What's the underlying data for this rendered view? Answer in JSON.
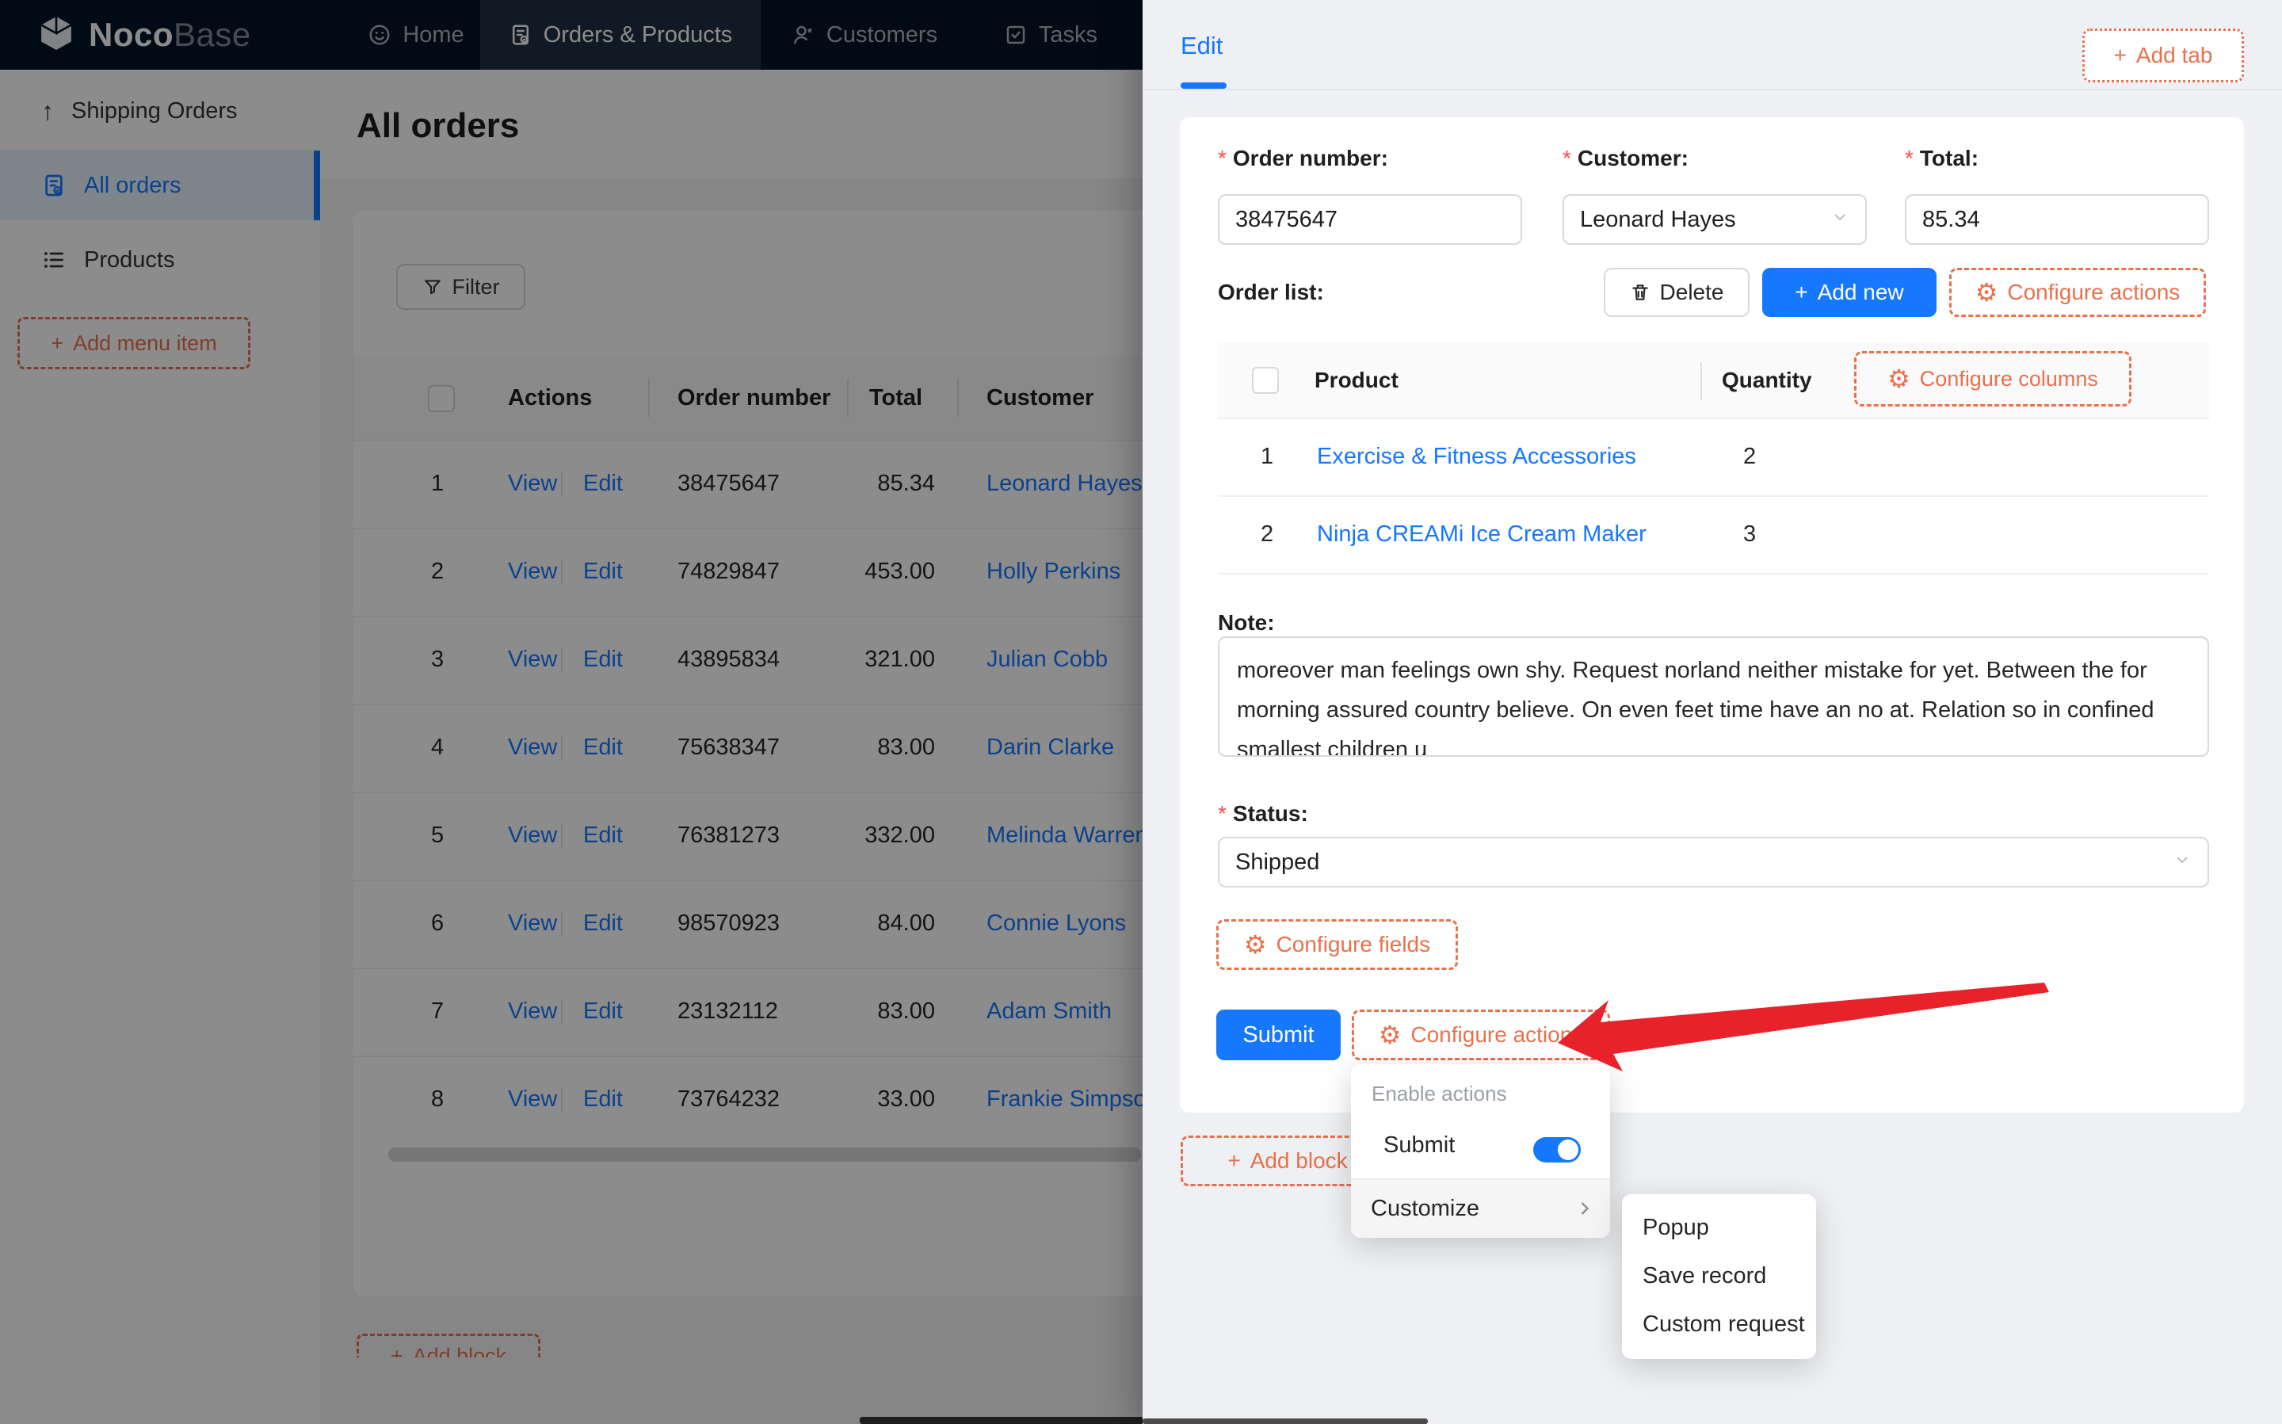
{
  "ui": {
    "plus": "+",
    "gear": "⚙",
    "required_marker": "*",
    "up_arrow": "↑"
  },
  "colors": {
    "accent": "#1677ff",
    "designer_orange": "#e8714c",
    "arrow_red": "#e8222a",
    "navbar_bg": "#001529"
  },
  "navbar": {
    "logo_primary": "Noco",
    "logo_secondary": "Base",
    "items": [
      {
        "label": "Home"
      },
      {
        "label": "Orders & Products"
      },
      {
        "label": "Customers"
      },
      {
        "label": "Tasks"
      }
    ]
  },
  "sidebar": {
    "items": [
      {
        "label": "Shipping Orders"
      },
      {
        "label": "All orders"
      },
      {
        "label": "Products"
      }
    ],
    "add_menu_item_label": "Add menu item"
  },
  "main": {
    "title": "All orders",
    "filter_label": "Filter",
    "add_block_label": "Add block",
    "table": {
      "columns": [
        "Actions",
        "Order number",
        "Total",
        "Customer"
      ],
      "action_labels": [
        "View",
        "Edit"
      ],
      "rows": [
        {
          "index": "1",
          "order_number": "38475647",
          "total": "85.34",
          "customer": "Leonard Hayes"
        },
        {
          "index": "2",
          "order_number": "74829847",
          "total": "453.00",
          "customer": "Holly Perkins"
        },
        {
          "index": "3",
          "order_number": "43895834",
          "total": "321.00",
          "customer": "Julian Cobb"
        },
        {
          "index": "4",
          "order_number": "75638347",
          "total": "83.00",
          "customer": "Darin Clarke"
        },
        {
          "index": "5",
          "order_number": "76381273",
          "total": "332.00",
          "customer": "Melinda Warren"
        },
        {
          "index": "6",
          "order_number": "98570923",
          "total": "84.00",
          "customer": "Connie Lyons"
        },
        {
          "index": "7",
          "order_number": "23132112",
          "total": "83.00",
          "customer": "Adam Smith"
        },
        {
          "index": "8",
          "order_number": "73764232",
          "total": "33.00",
          "customer": "Frankie Simpson"
        }
      ]
    }
  },
  "drawer": {
    "tab_label": "Edit",
    "add_tab_label": "Add tab",
    "form": {
      "order_number_label": "Order number:",
      "order_number_value": "38475647",
      "customer_label": "Customer:",
      "customer_value": "Leonard Hayes",
      "total_label": "Total:",
      "total_value": "85.34",
      "order_list_label": "Order list:",
      "note_label": "Note:",
      "note_value": "moreover man feelings own shy. Request norland neither mistake for yet. Between the for morning assured country believe. On even feet time have an no at. Relation so in confined smallest children u",
      "status_label": "Status:",
      "status_value": "Shipped"
    },
    "buttons": {
      "delete": "Delete",
      "add_new": "Add new",
      "configure_actions": "Configure actions",
      "configure_columns": "Configure columns",
      "configure_fields": "Configure fields",
      "submit": "Submit",
      "add_block": "Add block"
    },
    "order_list": {
      "columns": [
        "Product",
        "Quantity"
      ],
      "rows": [
        {
          "index": "1",
          "product": "Exercise & Fitness Accessories",
          "quantity": "2"
        },
        {
          "index": "2",
          "product": "Ninja CREAMi Ice Cream Maker",
          "quantity": "3"
        }
      ]
    }
  },
  "dropdown": {
    "header": "Enable actions",
    "submit_label": "Submit",
    "customize_label": "Customize",
    "submenu": [
      "Popup",
      "Save record",
      "Custom request"
    ]
  }
}
